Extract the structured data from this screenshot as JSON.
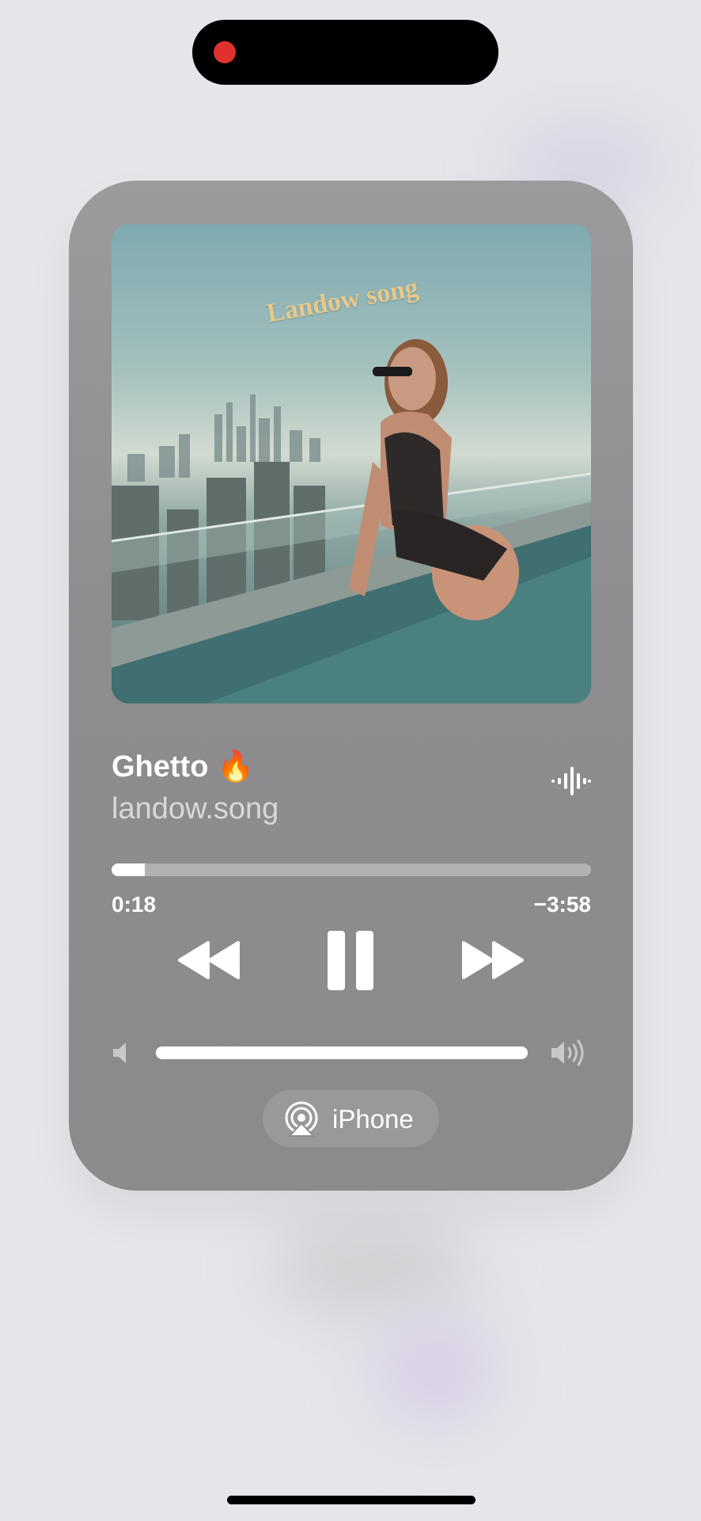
{
  "player": {
    "artwork_text": "Landow song",
    "title": "Ghetto 🔥",
    "artist": "landow.song",
    "progress_fraction": 0.07,
    "time_elapsed": "0:18",
    "time_remaining": "−3:58",
    "volume_fraction": 1.0,
    "output_device": "iPhone"
  },
  "icons": {
    "status": "recording-dot-icon",
    "waveform": "audio-waveform-icon",
    "rewind": "rewind-icon",
    "pause": "pause-icon",
    "forward": "fast-forward-icon",
    "volume_low": "speaker-low-icon",
    "volume_high": "speaker-high-icon",
    "airplay": "airplay-icon"
  },
  "colors": {
    "card": "#8d8c8f",
    "accent_text": "#ffffff",
    "recording_dot": "#e0322c"
  }
}
